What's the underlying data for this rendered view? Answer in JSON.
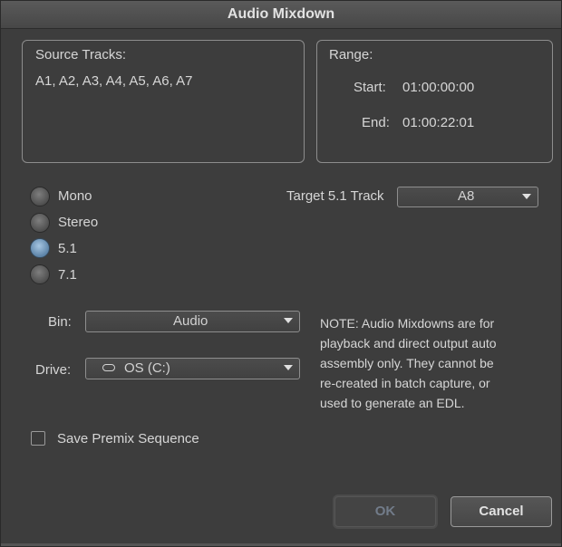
{
  "window": {
    "title": "Audio Mixdown"
  },
  "source_tracks": {
    "label": "Source Tracks:",
    "value": "A1, A2, A3, A4, A5, A6, A7"
  },
  "range": {
    "label": "Range:",
    "start_label": "Start:",
    "start_value": "01:00:00:00",
    "end_label": "End:",
    "end_value": "01:00:22:01"
  },
  "mix_format": {
    "options": [
      {
        "label": "Mono",
        "selected": false
      },
      {
        "label": "Stereo",
        "selected": false
      },
      {
        "label": "5.1",
        "selected": true
      },
      {
        "label": "7.1",
        "selected": false
      }
    ]
  },
  "target_track": {
    "label": "Target 5.1 Track",
    "value": "A8"
  },
  "bin": {
    "label": "Bin:",
    "value": "Audio"
  },
  "drive": {
    "label": "Drive:",
    "value": "OS (C:)",
    "icon": "drive-icon"
  },
  "note": "NOTE: Audio Mixdowns are for\nplayback and direct output auto\nassembly only.  They cannot be\nre-created in batch capture, or\nused to generate an EDL.",
  "save_premix": {
    "label": "Save Premix Sequence",
    "checked": false
  },
  "buttons": {
    "ok": "OK",
    "cancel": "Cancel"
  },
  "colors": {
    "background": "#3d3d3d",
    "selected_radio": "#5d84a8"
  }
}
